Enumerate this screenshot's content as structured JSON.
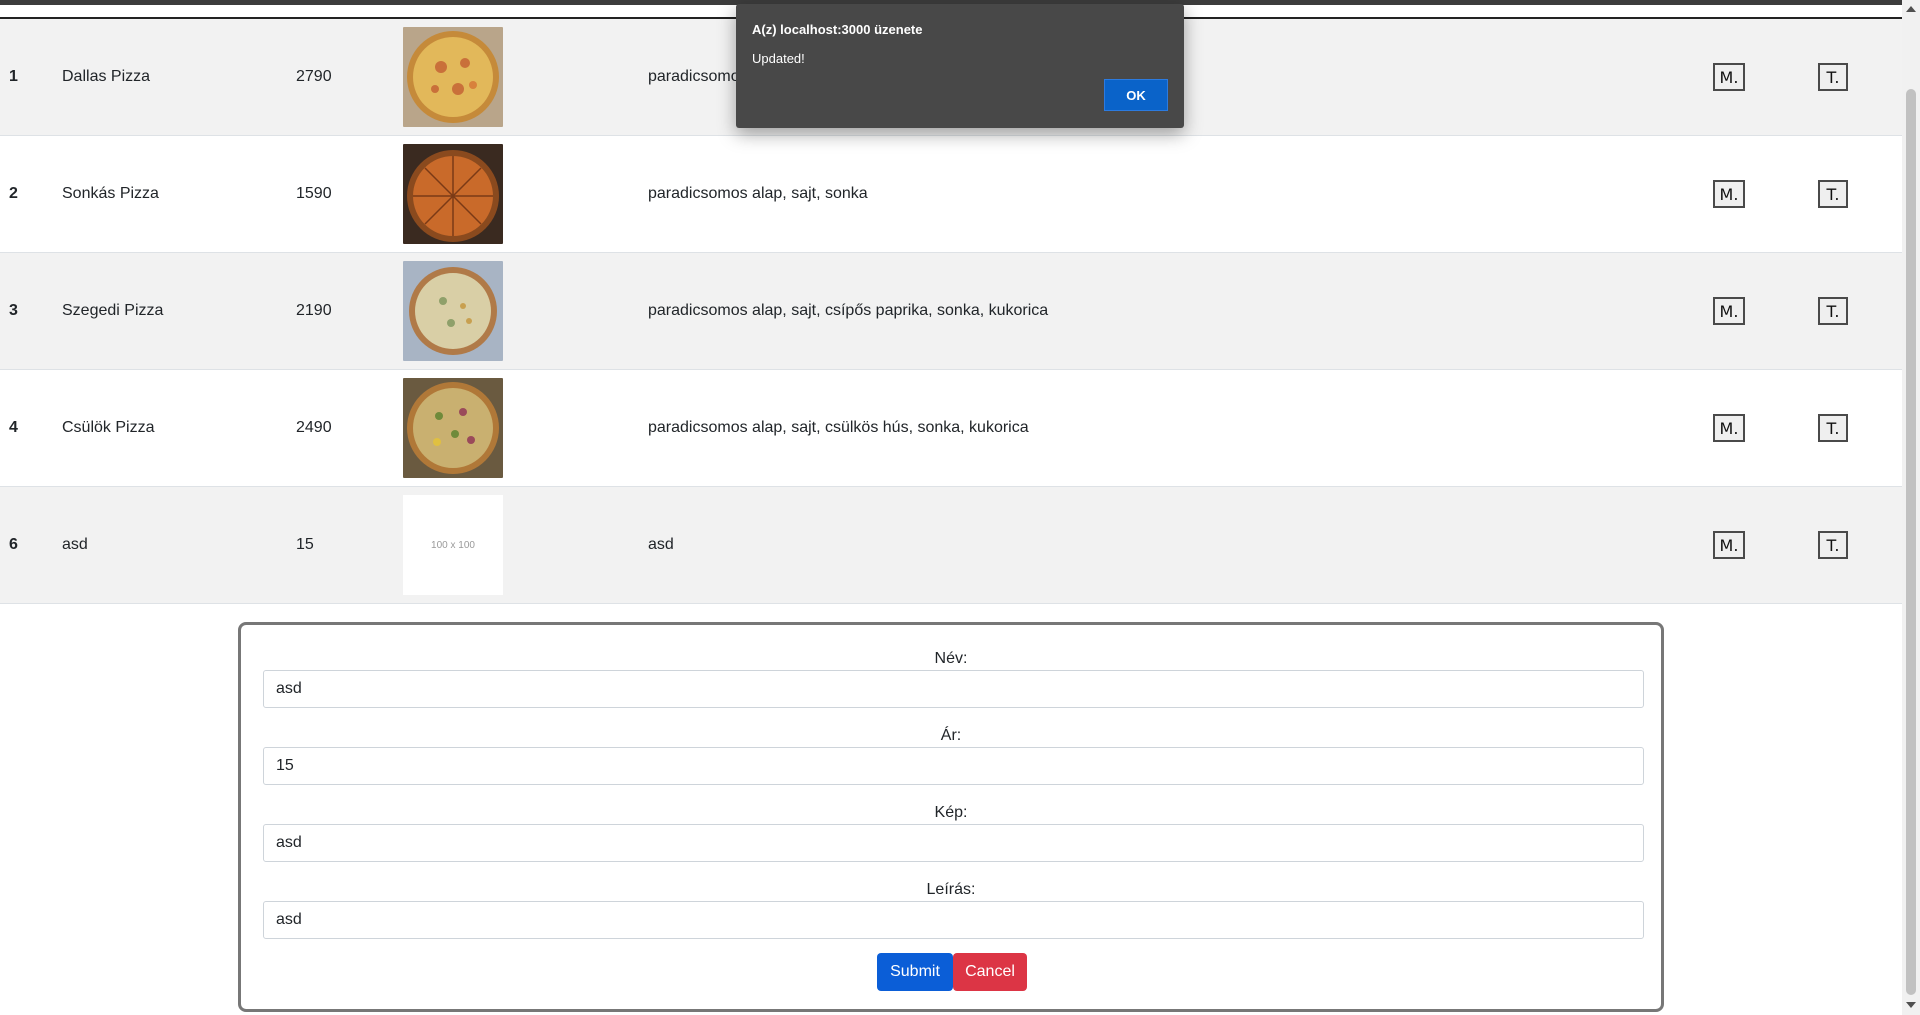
{
  "alert": {
    "title": "A(z) localhost:3000 üzenete",
    "message": "Updated!",
    "ok_label": "OK"
  },
  "table": {
    "rows": [
      {
        "id": "1",
        "name": "Dallas Pizza",
        "price": "2790",
        "image": "pizza-photo",
        "description": "paradicsomos alap, sajt, sonka, pepperóni",
        "edit_label": "M.",
        "delete_label": "T."
      },
      {
        "id": "2",
        "name": "Sonkás Pizza",
        "price": "1590",
        "image": "pizza-photo",
        "description": "paradicsomos alap, sajt, sonka",
        "edit_label": "M.",
        "delete_label": "T."
      },
      {
        "id": "3",
        "name": "Szegedi Pizza",
        "price": "2190",
        "image": "pizza-photo",
        "description": "paradicsomos alap, sajt, csípős paprika, sonka, kukorica",
        "edit_label": "M.",
        "delete_label": "T."
      },
      {
        "id": "4",
        "name": "Csülök Pizza",
        "price": "2490",
        "image": "pizza-photo",
        "description": "paradicsomos alap, sajt, csülkös hús, sonka, kukorica",
        "edit_label": "M.",
        "delete_label": "T."
      },
      {
        "id": "6",
        "name": "asd",
        "price": "15",
        "image": "placeholder",
        "placeholder_text": "100 x 100",
        "description": "asd",
        "edit_label": "M.",
        "delete_label": "T."
      }
    ]
  },
  "form": {
    "name_label": "Név:",
    "name_value": "asd",
    "price_label": "Ár:",
    "price_value": "15",
    "image_label": "Kép:",
    "image_value": "asd",
    "description_label": "Leírás:",
    "description_value": "asd",
    "submit_label": "Submit",
    "cancel_label": "Cancel"
  },
  "colors": {
    "submit": "#0b5ed7",
    "cancel": "#dc3545",
    "alert_bg": "#484848",
    "alert_ok": "#0a63c9",
    "row_stripe": "#f2f2f2"
  }
}
